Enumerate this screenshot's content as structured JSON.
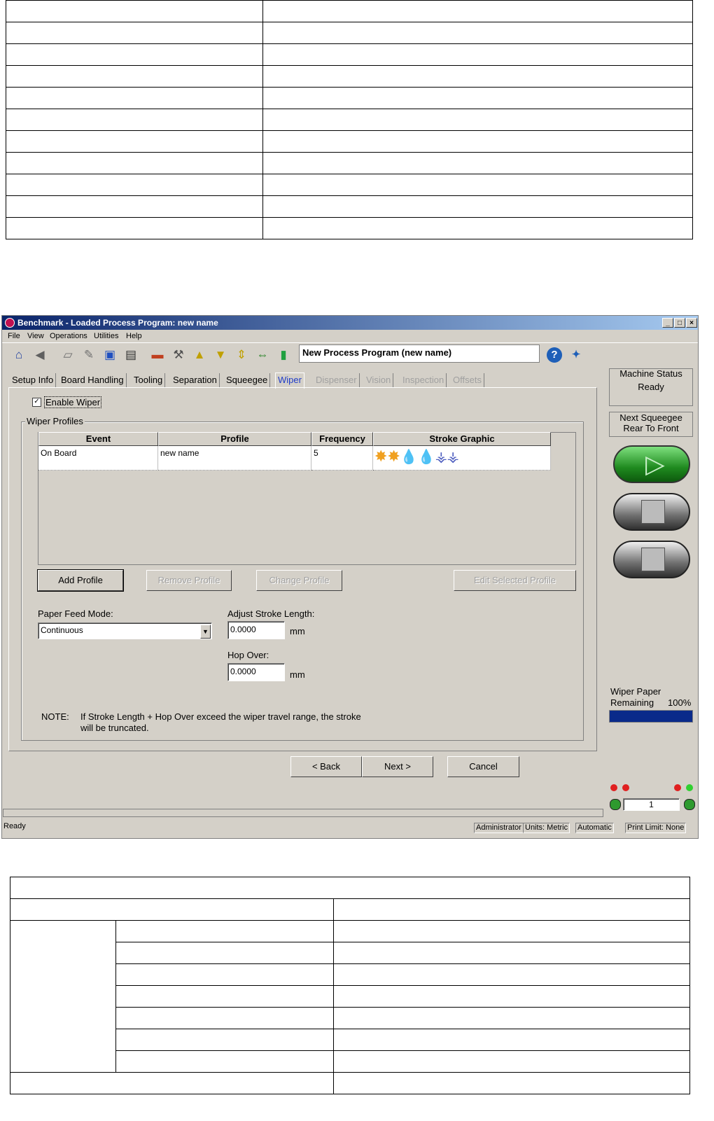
{
  "window": {
    "title": "Benchmark - Loaded Process Program:  new name",
    "menu": [
      "File",
      "View",
      "Operations",
      "Utilities",
      "Help"
    ],
    "program_name": "New Process Program (new name)"
  },
  "tabs": [
    {
      "label": "Setup Info",
      "state": "normal"
    },
    {
      "label": "Board Handling",
      "state": "normal"
    },
    {
      "label": "Tooling",
      "state": "normal"
    },
    {
      "label": "Separation",
      "state": "normal"
    },
    {
      "label": "Squeegee",
      "state": "normal"
    },
    {
      "label": "Wiper",
      "state": "active"
    },
    {
      "label": "Dispenser",
      "state": "disabled"
    },
    {
      "label": "Vision",
      "state": "disabled"
    },
    {
      "label": "Inspection",
      "state": "disabled"
    },
    {
      "label": "Offsets",
      "state": "disabled"
    }
  ],
  "wiper": {
    "enable_label": "Enable Wiper",
    "enabled": true,
    "profiles_group_label": "Wiper Profiles",
    "columns": [
      "Event",
      "Profile",
      "Frequency",
      "Stroke Graphic"
    ],
    "rows": [
      {
        "event": "On Board",
        "profile": "new name",
        "frequency": "5"
      }
    ],
    "buttons": {
      "add": "Add Profile",
      "remove": "Remove Profile",
      "change": "Change Profile",
      "edit": "Edit Selected Profile"
    },
    "paper_feed_label": "Paper Feed Mode:",
    "paper_feed_value": "Continuous",
    "stroke_label": "Adjust Stroke Length:",
    "stroke_value": "0.0000",
    "hop_label": "Hop Over:",
    "hop_value": "0.0000",
    "unit": "mm",
    "note_label": "NOTE:",
    "note_text_1": "If Stroke Length + Hop Over exceed the wiper travel range, the stroke",
    "note_text_2": "will be truncated."
  },
  "nav": {
    "back": "< Back",
    "next": "Next >",
    "cancel": "Cancel"
  },
  "side": {
    "machine_status_label": "Machine Status",
    "machine_status_value": "Ready",
    "next_squeegee_label": "Next Squeegee",
    "next_squeegee_value": "Rear To Front",
    "wiper_paper_label_1": "Wiper Paper",
    "wiper_paper_label_2": "Remaining",
    "wiper_paper_percent": "100%",
    "wiper_paper_fraction": 1.0,
    "counter_value": "1"
  },
  "status": {
    "left": "Ready",
    "user": "Administrator",
    "units": "Units: Metric",
    "mode": "Automatic",
    "print_limit": "Print Limit: None"
  },
  "colors": {
    "title_bar": "#0a246a",
    "active_tab": "#1f3cc8",
    "run_button": "#2e9a2e",
    "progress_fill": "#0a2a8a"
  }
}
